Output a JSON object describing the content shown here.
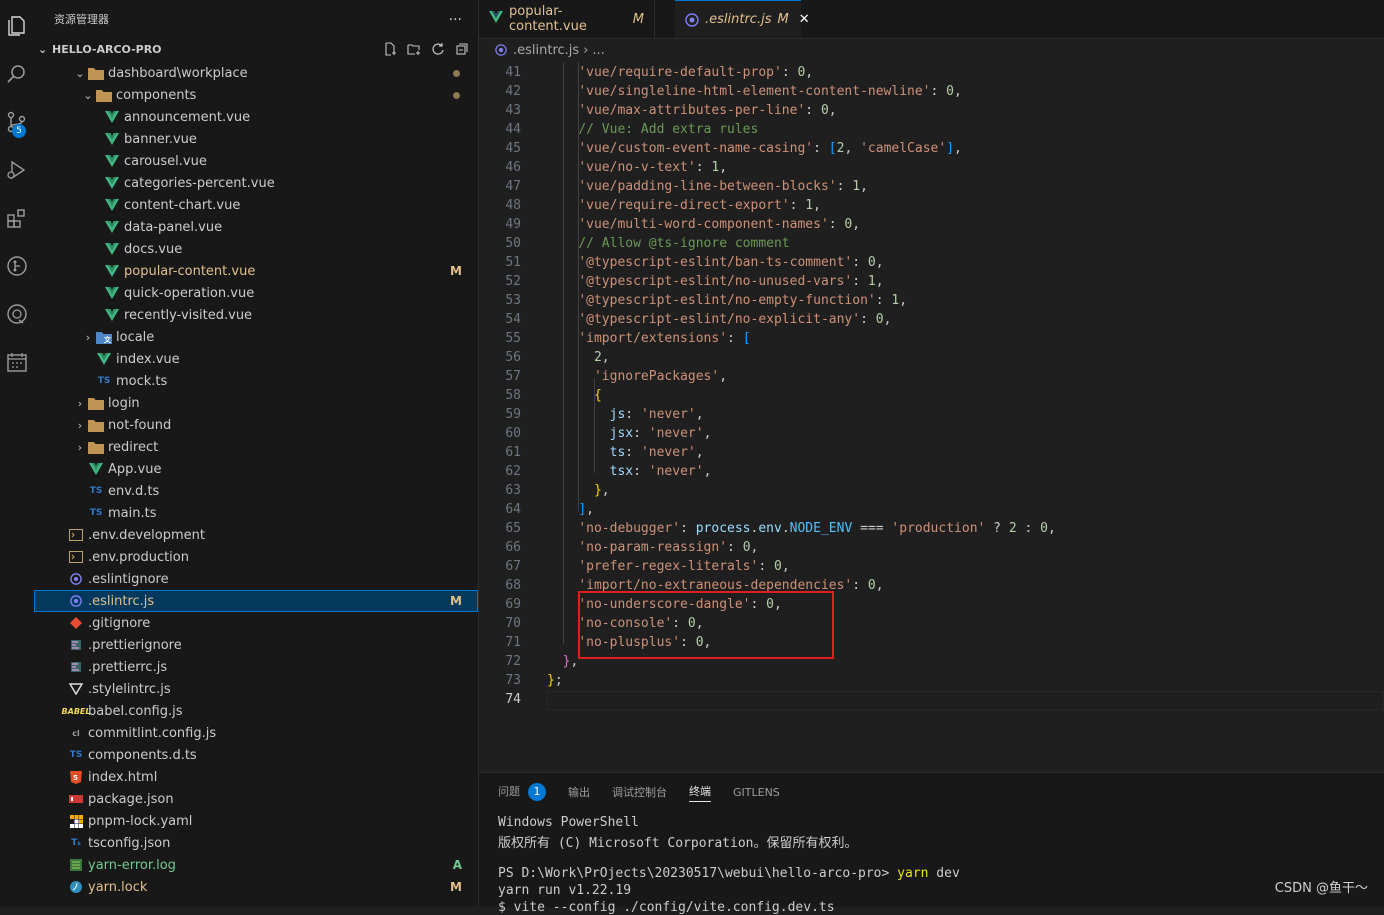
{
  "activity_bar": {
    "items": [
      "explorer-icon",
      "search-icon",
      "source-control-icon",
      "run-debug-icon",
      "extensions-icon",
      "gitlens-icon",
      "remote-icon",
      "calendar-icon"
    ],
    "scm_badge": "5"
  },
  "sidebar": {
    "title": "资源管理器",
    "more": "···",
    "project": "HELLO-ARCO-PRO",
    "tree": [
      {
        "label": "dashboard\\workplace",
        "icon": "folder",
        "chev": "open",
        "indent": 1,
        "dot": true
      },
      {
        "label": "components",
        "icon": "folder",
        "chev": "open",
        "indent": 2,
        "dot": true
      },
      {
        "label": "announcement.vue",
        "icon": "vue",
        "indent": 3
      },
      {
        "label": "banner.vue",
        "icon": "vue",
        "indent": 3
      },
      {
        "label": "carousel.vue",
        "icon": "vue",
        "indent": 3
      },
      {
        "label": "categories-percent.vue",
        "icon": "vue",
        "indent": 3
      },
      {
        "label": "content-chart.vue",
        "icon": "vue",
        "indent": 3
      },
      {
        "label": "data-panel.vue",
        "icon": "vue",
        "indent": 3
      },
      {
        "label": "docs.vue",
        "icon": "vue",
        "indent": 3
      },
      {
        "label": "popular-content.vue",
        "icon": "vue",
        "indent": 3,
        "status": "M"
      },
      {
        "label": "quick-operation.vue",
        "icon": "vue",
        "indent": 3
      },
      {
        "label": "recently-visited.vue",
        "icon": "vue",
        "indent": 3
      },
      {
        "label": "locale",
        "icon": "folder-locale",
        "chev": "closed",
        "indent": 2
      },
      {
        "label": "index.vue",
        "icon": "vue",
        "indent": 2
      },
      {
        "label": "mock.ts",
        "icon": "ts",
        "indent": 2
      },
      {
        "label": "login",
        "icon": "folder",
        "chev": "closed",
        "indent": 1
      },
      {
        "label": "not-found",
        "icon": "folder",
        "chev": "closed",
        "indent": 1
      },
      {
        "label": "redirect",
        "icon": "folder",
        "chev": "closed",
        "indent": 1
      },
      {
        "label": "App.vue",
        "icon": "vue",
        "indent": 1
      },
      {
        "label": "env.d.ts",
        "icon": "ts",
        "indent": 1
      },
      {
        "label": "main.ts",
        "icon": "ts",
        "indent": 1
      },
      {
        "label": ".env.development",
        "icon": "env",
        "indent": 0
      },
      {
        "label": ".env.production",
        "icon": "env",
        "indent": 0
      },
      {
        "label": ".eslintignore",
        "icon": "eslint",
        "indent": 0
      },
      {
        "label": ".eslintrc.js",
        "icon": "eslint",
        "indent": 0,
        "status": "M",
        "selected": true
      },
      {
        "label": ".gitignore",
        "icon": "git",
        "indent": 0
      },
      {
        "label": ".prettierignore",
        "icon": "prettier",
        "indent": 0
      },
      {
        "label": ".prettierrc.js",
        "icon": "prettier",
        "indent": 0
      },
      {
        "label": ".stylelintrc.js",
        "icon": "stylelint",
        "indent": 0
      },
      {
        "label": "babel.config.js",
        "icon": "babel",
        "indent": 0
      },
      {
        "label": "commitlint.config.js",
        "icon": "commitlint",
        "indent": 0
      },
      {
        "label": "components.d.ts",
        "icon": "ts",
        "indent": 0
      },
      {
        "label": "index.html",
        "icon": "html",
        "indent": 0
      },
      {
        "label": "package.json",
        "icon": "npm",
        "indent": 0
      },
      {
        "label": "pnpm-lock.yaml",
        "icon": "pnpm",
        "indent": 0
      },
      {
        "label": "tsconfig.json",
        "icon": "tsconfig",
        "indent": 0
      },
      {
        "label": "yarn-error.log",
        "icon": "log",
        "indent": 0,
        "status": "A"
      },
      {
        "label": "yarn.lock",
        "icon": "yarn",
        "indent": 0,
        "status": "M"
      }
    ]
  },
  "tabs": [
    {
      "label": "popular-content.vue",
      "status": "M"
    },
    {
      "label": ".eslintrc.js",
      "status": "M",
      "close": "✕"
    }
  ],
  "breadcrumb": {
    "file": ".eslintrc.js",
    "sep": "›",
    "more": "..."
  },
  "editor": {
    "first_line": 41,
    "current_line": 74,
    "lines": [
      [
        [
          "    ",
          "p"
        ],
        [
          "'vue/require-default-prop'",
          "s"
        ],
        [
          ": ",
          "p"
        ],
        [
          "0",
          "n"
        ],
        [
          ",",
          "p"
        ]
      ],
      [
        [
          "    ",
          "p"
        ],
        [
          "'vue/singleline-html-element-content-newline'",
          "s"
        ],
        [
          ": ",
          "p"
        ],
        [
          "0",
          "n"
        ],
        [
          ",",
          "p"
        ]
      ],
      [
        [
          "    ",
          "p"
        ],
        [
          "'vue/max-attributes-per-line'",
          "s"
        ],
        [
          ": ",
          "p"
        ],
        [
          "0",
          "n"
        ],
        [
          ",",
          "p"
        ]
      ],
      [
        [
          "    ",
          "p"
        ],
        [
          "// Vue: Add extra rules",
          "c"
        ]
      ],
      [
        [
          "    ",
          "p"
        ],
        [
          "'vue/custom-event-name-casing'",
          "s"
        ],
        [
          ": ",
          "p"
        ],
        [
          "[",
          "b3"
        ],
        [
          "2",
          "n"
        ],
        [
          ", ",
          "p"
        ],
        [
          "'camelCase'",
          "s"
        ],
        [
          "]",
          "b3"
        ],
        [
          ",",
          "p"
        ]
      ],
      [
        [
          "    ",
          "p"
        ],
        [
          "'vue/no-v-text'",
          "s"
        ],
        [
          ": ",
          "p"
        ],
        [
          "1",
          "n"
        ],
        [
          ",",
          "p"
        ]
      ],
      [
        [
          "    ",
          "p"
        ],
        [
          "'vue/padding-line-between-blocks'",
          "s"
        ],
        [
          ": ",
          "p"
        ],
        [
          "1",
          "n"
        ],
        [
          ",",
          "p"
        ]
      ],
      [
        [
          "    ",
          "p"
        ],
        [
          "'vue/require-direct-export'",
          "s"
        ],
        [
          ": ",
          "p"
        ],
        [
          "1",
          "n"
        ],
        [
          ",",
          "p"
        ]
      ],
      [
        [
          "    ",
          "p"
        ],
        [
          "'vue/multi-word-component-names'",
          "s"
        ],
        [
          ": ",
          "p"
        ],
        [
          "0",
          "n"
        ],
        [
          ",",
          "p"
        ]
      ],
      [
        [
          "    ",
          "p"
        ],
        [
          "// Allow @ts-ignore comment",
          "c"
        ]
      ],
      [
        [
          "    ",
          "p"
        ],
        [
          "'@typescript-eslint/ban-ts-comment'",
          "s"
        ],
        [
          ": ",
          "p"
        ],
        [
          "0",
          "n"
        ],
        [
          ",",
          "p"
        ]
      ],
      [
        [
          "    ",
          "p"
        ],
        [
          "'@typescript-eslint/no-unused-vars'",
          "s"
        ],
        [
          ": ",
          "p"
        ],
        [
          "1",
          "n"
        ],
        [
          ",",
          "p"
        ]
      ],
      [
        [
          "    ",
          "p"
        ],
        [
          "'@typescript-eslint/no-empty-function'",
          "s"
        ],
        [
          ": ",
          "p"
        ],
        [
          "1",
          "n"
        ],
        [
          ",",
          "p"
        ]
      ],
      [
        [
          "    ",
          "p"
        ],
        [
          "'@typescript-eslint/no-explicit-any'",
          "s"
        ],
        [
          ": ",
          "p"
        ],
        [
          "0",
          "n"
        ],
        [
          ",",
          "p"
        ]
      ],
      [
        [
          "    ",
          "p"
        ],
        [
          "'import/extensions'",
          "s"
        ],
        [
          ": ",
          "p"
        ],
        [
          "[",
          "b3"
        ]
      ],
      [
        [
          "      ",
          "p"
        ],
        [
          "2",
          "n"
        ],
        [
          ",",
          "p"
        ]
      ],
      [
        [
          "      ",
          "p"
        ],
        [
          "'ignorePackages'",
          "s"
        ],
        [
          ",",
          "p"
        ]
      ],
      [
        [
          "      ",
          "p"
        ],
        [
          "{",
          "b1"
        ]
      ],
      [
        [
          "        ",
          "p"
        ],
        [
          "js",
          "prop"
        ],
        [
          ": ",
          "p"
        ],
        [
          "'never'",
          "s"
        ],
        [
          ",",
          "p"
        ]
      ],
      [
        [
          "        ",
          "p"
        ],
        [
          "jsx",
          "prop"
        ],
        [
          ": ",
          "p"
        ],
        [
          "'never'",
          "s"
        ],
        [
          ",",
          "p"
        ]
      ],
      [
        [
          "        ",
          "p"
        ],
        [
          "ts",
          "prop"
        ],
        [
          ": ",
          "p"
        ],
        [
          "'never'",
          "s"
        ],
        [
          ",",
          "p"
        ]
      ],
      [
        [
          "        ",
          "p"
        ],
        [
          "tsx",
          "prop"
        ],
        [
          ": ",
          "p"
        ],
        [
          "'never'",
          "s"
        ],
        [
          ",",
          "p"
        ]
      ],
      [
        [
          "      ",
          "p"
        ],
        [
          "}",
          "b1"
        ],
        [
          ",",
          "p"
        ]
      ],
      [
        [
          "    ",
          "p"
        ],
        [
          "]",
          "b3"
        ],
        [
          ",",
          "p"
        ]
      ],
      [
        [
          "    ",
          "p"
        ],
        [
          "'no-debugger'",
          "s"
        ],
        [
          ": ",
          "p"
        ],
        [
          "process",
          "prop"
        ],
        [
          ".",
          "p"
        ],
        [
          "env",
          "prop"
        ],
        [
          ".",
          "p"
        ],
        [
          "NODE_ENV",
          "env"
        ],
        [
          " === ",
          "p"
        ],
        [
          "'production'",
          "s"
        ],
        [
          " ? ",
          "p"
        ],
        [
          "2",
          "n"
        ],
        [
          " : ",
          "p"
        ],
        [
          "0",
          "n"
        ],
        [
          ",",
          "p"
        ]
      ],
      [
        [
          "    ",
          "p"
        ],
        [
          "'no-param-reassign'",
          "s"
        ],
        [
          ": ",
          "p"
        ],
        [
          "0",
          "n"
        ],
        [
          ",",
          "p"
        ]
      ],
      [
        [
          "    ",
          "p"
        ],
        [
          "'prefer-regex-literals'",
          "s"
        ],
        [
          ": ",
          "p"
        ],
        [
          "0",
          "n"
        ],
        [
          ",",
          "p"
        ]
      ],
      [
        [
          "    ",
          "p"
        ],
        [
          "'import/no-extraneous-dependencies'",
          "s"
        ],
        [
          ": ",
          "p"
        ],
        [
          "0",
          "n"
        ],
        [
          ",",
          "p"
        ]
      ],
      [
        [
          "    ",
          "p"
        ],
        [
          "'no-underscore-dangle'",
          "s"
        ],
        [
          ": ",
          "p"
        ],
        [
          "0",
          "n"
        ],
        [
          ",",
          "p"
        ]
      ],
      [
        [
          "    ",
          "p"
        ],
        [
          "'no-console'",
          "s"
        ],
        [
          ": ",
          "p"
        ],
        [
          "0",
          "n"
        ],
        [
          ",",
          "p"
        ]
      ],
      [
        [
          "    ",
          "p"
        ],
        [
          "'no-plusplus'",
          "s"
        ],
        [
          ": ",
          "p"
        ],
        [
          "0",
          "n"
        ],
        [
          ",",
          "p"
        ]
      ],
      [
        [
          "  ",
          "p"
        ],
        [
          "}",
          "b2"
        ],
        [
          ",",
          "p"
        ]
      ],
      [
        [
          "}",
          "b1"
        ],
        [
          ";",
          "p"
        ]
      ],
      [
        [
          "",
          "p"
        ]
      ]
    ]
  },
  "panel": {
    "tabs": [
      {
        "label": "问题",
        "badge": "1"
      },
      {
        "label": "输出"
      },
      {
        "label": "调试控制台"
      },
      {
        "label": "终端",
        "active": true
      },
      {
        "label": "GITLENS"
      }
    ],
    "terminal": {
      "line1": "Windows PowerShell",
      "line2": "版权所有 (C) Microsoft Corporation。保留所有权利。",
      "prompt": "PS D:\\Work\\PrOjects\\20230517\\webui\\hello-arco-pro> ",
      "cmd": "yarn",
      "arg": " dev",
      "line4": "yarn run v1.22.19",
      "line5": "$ vite --config ./config/vite.config.dev.ts"
    }
  },
  "watermark": "CSDN @鱼干～",
  "colors": {
    "accent": "#0078d4",
    "modified": "#e2c08d",
    "added": "#73c991",
    "highlight_box": "#e01e1e"
  }
}
